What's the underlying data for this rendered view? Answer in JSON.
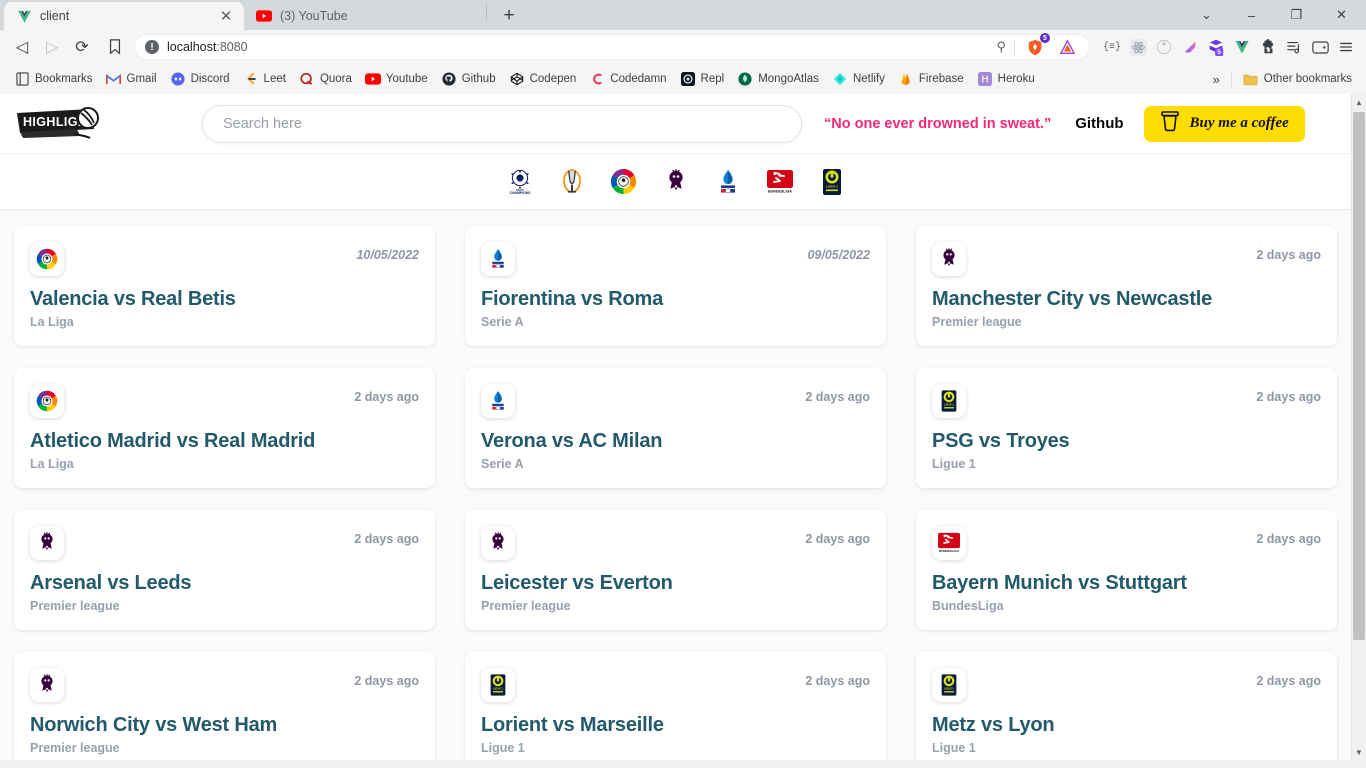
{
  "browser": {
    "tabs": [
      {
        "title": "client",
        "favicon": "vue-icon",
        "active": true,
        "has_close": true
      },
      {
        "title": "(3) YouTube",
        "favicon": "youtube-icon",
        "active": false,
        "has_close": false
      }
    ],
    "new_tab_label": "+",
    "window_controls": {
      "minimize": "–",
      "maximize": "❐",
      "close": "✕",
      "list_tabs": "⌄"
    },
    "nav": {
      "back": "◁",
      "forward": "▷",
      "reload": "⟳"
    },
    "omnibox": {
      "security_icon": "not-secure-icon",
      "url_host": "localhost",
      "url_port": ":8080",
      "zoom_icon": "search-zoom-icon"
    },
    "toolbar_extensions": [
      "json-viewer-icon",
      "react-devtools-icon",
      "redux-devtools-icon",
      "gradient-extension-icon",
      "vuex-devtools-icon",
      "vue-devtools-icon",
      "puzzle-extensions-icon",
      "playlist-icon",
      "wallet-icon",
      "chrome-menu-icon"
    ],
    "omni_right_icons": [
      "brave-shields-icon",
      "brave-rewards-icon"
    ],
    "shield_badge": "5",
    "bookmarks": [
      {
        "label": "Bookmarks",
        "icon": "book-icon"
      },
      {
        "label": "Gmail",
        "icon": "gmail-icon"
      },
      {
        "label": "Discord",
        "icon": "discord-icon"
      },
      {
        "label": "Leet",
        "icon": "leetcode-icon"
      },
      {
        "label": "Quora",
        "icon": "quora-icon"
      },
      {
        "label": "Youtube",
        "icon": "youtube-icon"
      },
      {
        "label": "Github",
        "icon": "github-icon"
      },
      {
        "label": "Codepen",
        "icon": "codepen-icon"
      },
      {
        "label": "Codedamn",
        "icon": "codedamn-icon"
      },
      {
        "label": "Repl",
        "icon": "replit-icon"
      },
      {
        "label": "MongoAtlas",
        "icon": "mongodb-icon"
      },
      {
        "label": "Netlify",
        "icon": "netlify-icon"
      },
      {
        "label": "Firebase",
        "icon": "firebase-icon"
      },
      {
        "label": "Heroku",
        "icon": "heroku-icon"
      }
    ],
    "bookmarks_overflow": "»",
    "other_bookmarks": {
      "label": "Other bookmarks",
      "icon": "folder-icon"
    }
  },
  "site": {
    "logo_text": "HIGHLIGHTS",
    "search": {
      "placeholder": "Search here",
      "value": ""
    },
    "quote": "“No one ever drowned in sweat.”",
    "github_label": "Github",
    "coffee_button": "Buy me a coffee",
    "leagues": [
      {
        "name": "champions-league",
        "title": "UEFA Champions League"
      },
      {
        "name": "europa-league",
        "title": "UEFA Europa League"
      },
      {
        "name": "la-liga",
        "title": "La Liga"
      },
      {
        "name": "premier-league",
        "title": "Premier league"
      },
      {
        "name": "serie-a",
        "title": "Serie A"
      },
      {
        "name": "bundesliga",
        "title": "BundesLiga"
      },
      {
        "name": "ligue-1",
        "title": "Ligue 1"
      }
    ],
    "colors": {
      "quote": "#f5287a",
      "coffee_bg": "#ffdd00",
      "card_title": "#235a6b",
      "card_league": "#98a0ad",
      "card_date": "#8f96a3",
      "page_bg": "#fafafa"
    },
    "cards": [
      {
        "title": "Valencia vs Real Betis",
        "league": "La Liga",
        "date": "10/05/2022",
        "date_style": "italic",
        "badge": "la-liga"
      },
      {
        "title": "Fiorentina vs Roma",
        "league": "Serie A",
        "date": "09/05/2022",
        "date_style": "italic",
        "badge": "serie-a"
      },
      {
        "title": "Manchester City vs Newcastle",
        "league": "Premier league",
        "date": "2 days ago",
        "date_style": "plain",
        "badge": "premier-league"
      },
      {
        "title": "Atletico Madrid vs Real Madrid",
        "league": "La Liga",
        "date": "2 days ago",
        "date_style": "plain",
        "badge": "la-liga"
      },
      {
        "title": "Verona vs AC Milan",
        "league": "Serie A",
        "date": "2 days ago",
        "date_style": "plain",
        "badge": "serie-a"
      },
      {
        "title": "PSG vs Troyes",
        "league": "Ligue 1",
        "date": "2 days ago",
        "date_style": "plain",
        "badge": "ligue-1"
      },
      {
        "title": "Arsenal vs Leeds",
        "league": "Premier league",
        "date": "2 days ago",
        "date_style": "plain",
        "badge": "premier-league"
      },
      {
        "title": "Leicester vs Everton",
        "league": "Premier league",
        "date": "2 days ago",
        "date_style": "plain",
        "badge": "premier-league"
      },
      {
        "title": "Bayern Munich vs Stuttgart",
        "league": "BundesLiga",
        "date": "2 days ago",
        "date_style": "plain",
        "badge": "bundesliga"
      },
      {
        "title": "Norwich City vs West Ham",
        "league": "Premier league",
        "date": "2 days ago",
        "date_style": "plain",
        "badge": "premier-league"
      },
      {
        "title": "Lorient vs Marseille",
        "league": "Ligue 1",
        "date": "2 days ago",
        "date_style": "plain",
        "badge": "ligue-1"
      },
      {
        "title": "Metz vs Lyon",
        "league": "Ligue 1",
        "date": "2 days ago",
        "date_style": "plain",
        "badge": "ligue-1"
      }
    ]
  }
}
